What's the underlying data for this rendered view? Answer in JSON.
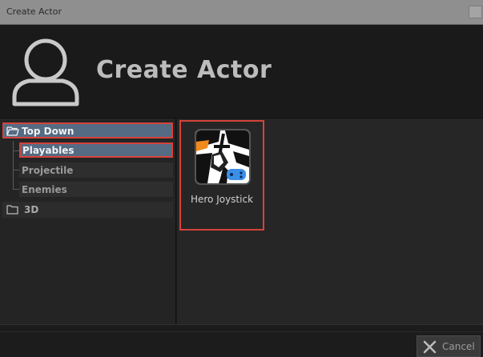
{
  "window": {
    "title": "Create Actor"
  },
  "header": {
    "title": "Create Actor",
    "icon": "user-silhouette-icon"
  },
  "tree": {
    "root": {
      "label": "Top Down",
      "icon": "folder-open-icon",
      "expanded": true
    },
    "children": [
      {
        "label": "Playables",
        "selected": true
      },
      {
        "label": "Projectile",
        "selected": false
      },
      {
        "label": "Enemies",
        "selected": false
      }
    ],
    "other": {
      "label": "3D",
      "icon": "folder-icon"
    }
  },
  "grid": {
    "items": [
      {
        "label": "Hero Joystick",
        "icon": "hero-joystick-icon"
      }
    ]
  },
  "footer": {
    "cancel_label": "Cancel",
    "cancel_icon": "close-icon"
  },
  "colors": {
    "selection": "#556b84",
    "highlight_border": "#d4433a",
    "accent_blue": "#3a8fe8",
    "accent_orange": "#f08a1c"
  }
}
